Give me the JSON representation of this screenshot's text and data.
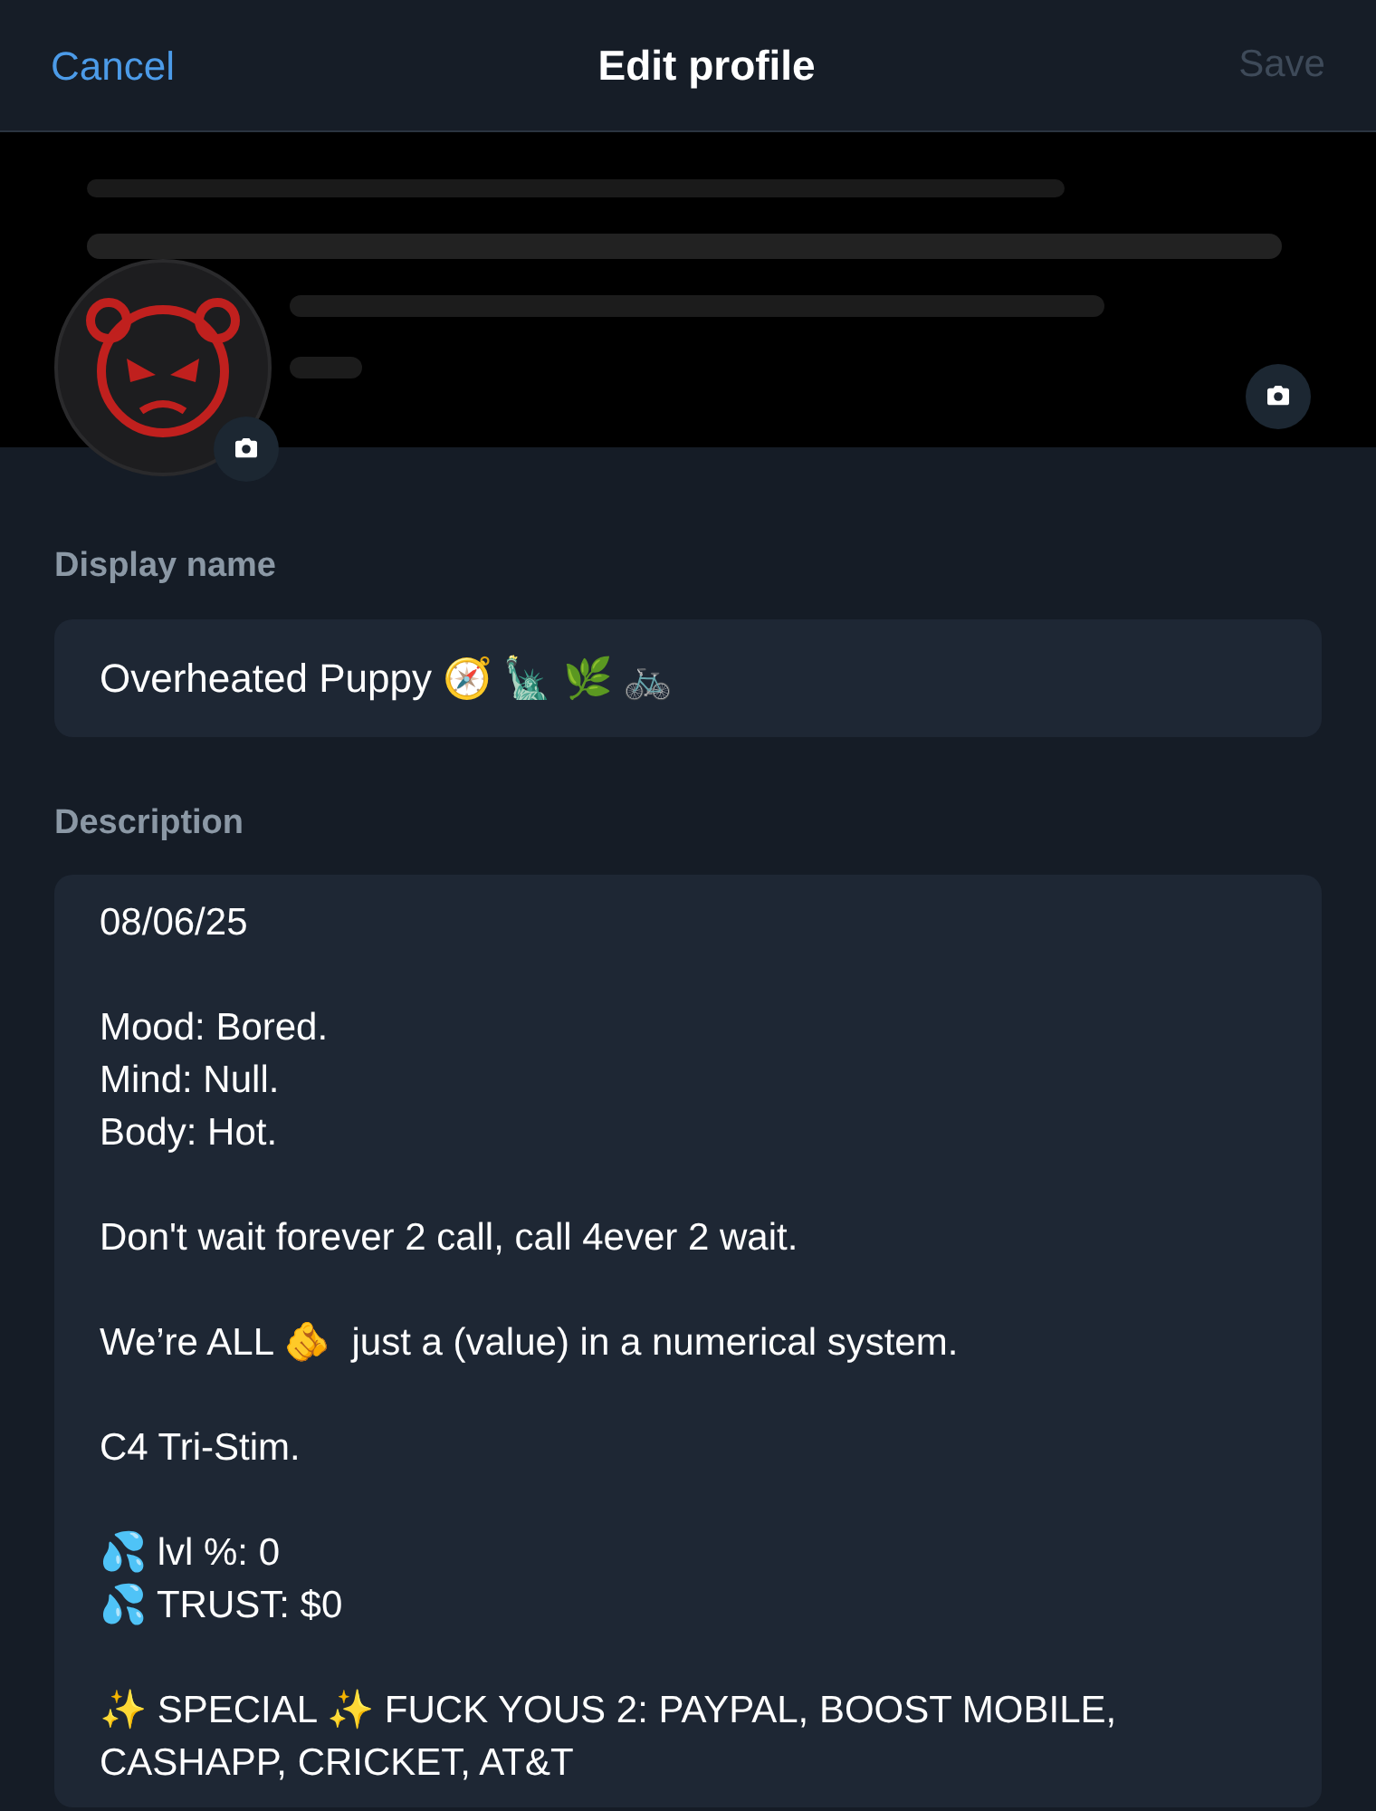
{
  "header": {
    "cancel": "Cancel",
    "title": "Edit profile",
    "save": "Save",
    "save_disabled": true
  },
  "display_name": {
    "label": "Display name",
    "value": "Overheated Puppy 🧭 🗽 🌿 🚲"
  },
  "description": {
    "label": "Description",
    "value": "08/06/25\n\nMood: Bored.\nMind: Null.\nBody: Hot.\n\nDon't wait forever 2 call, call 4ever 2 wait.\n\nWe’re ALL 🫵  just a (value) in a numerical system.\n\nC4 Tri-Stim.\n\n💦 lvl %: 0\n💦 TRUST: $0\n\n✨ SPECIAL ✨ FUCK YOUS 2: PAYPAL, BOOST MOBILE, CASHAPP, CRICKET, AT&T"
  }
}
